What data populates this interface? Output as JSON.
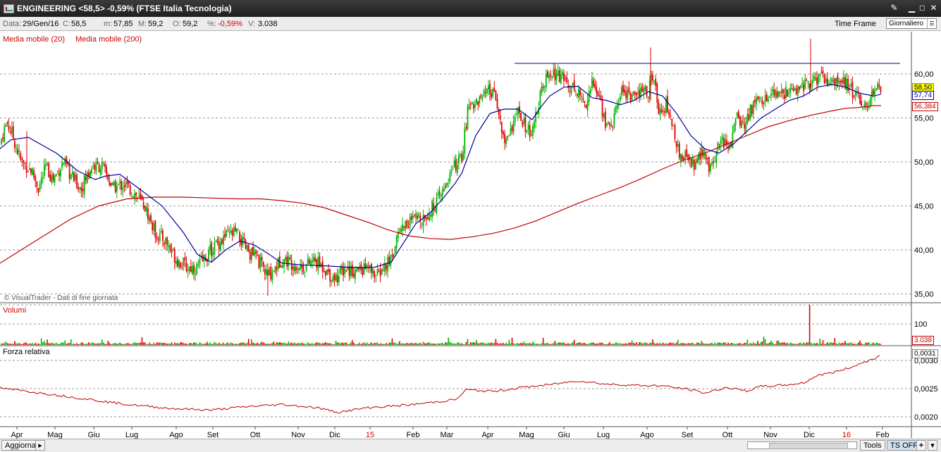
{
  "window": {
    "title": "ENGINEERING <58,5> -0,59%  (FTSE Italia Tecnologia)",
    "controls": [
      "pin-icon",
      "minimize-icon",
      "maximize-icon",
      "close-icon"
    ]
  },
  "info": {
    "date_label": "Data:",
    "date": "29/Gen/16",
    "close_label": "C:",
    "close": "58,5",
    "min_label": "m:",
    "min": "57,85",
    "max_label": "M:",
    "max": "59,2",
    "open_label": "O:",
    "open": "59,2",
    "pct_label": "%:",
    "pct": "-0,59%",
    "vol_label": "V:",
    "vol": "3.038",
    "timeframe_label": "Time Frame",
    "timeframe_value": "Giornaliero"
  },
  "indicators": {
    "ma20": "Media mobile (20)",
    "ma200": "Media mobile (200)",
    "copyright": "© VisualTrader - Dati di fine giornata",
    "volumes": "Volumi",
    "relative_strength": "Forza relativa"
  },
  "colors": {
    "up": "#00b400",
    "down": "#e00000",
    "ma20": "#0000a0",
    "ma200": "#c00000",
    "resistance": "#000080",
    "grid": "#9a9a9a",
    "price_box": "#ffff00",
    "ma_box": "#ffffff"
  },
  "chart_data": {
    "type": "candlestick",
    "price_axis": {
      "ticks": [
        "60,00",
        "55,00",
        "50,00",
        "45,00",
        "40,00",
        "35,00"
      ],
      "ylim": [
        34.5,
        64
      ]
    },
    "last_values": {
      "close": "58,50",
      "ma20": "57,74",
      "ma200": "56,384"
    },
    "volume_axis": {
      "ticks": [
        "100"
      ],
      "last": "3.038"
    },
    "rs_axis": {
      "ticks": [
        "0,0030",
        "0,0025",
        "0,0020"
      ],
      "last": "0,0031"
    },
    "x_labels": [
      "Apr",
      "Mag",
      "Giu",
      "Lug",
      "Ago",
      "Set",
      "Ott",
      "Nov",
      "Dic",
      "15",
      "Feb",
      "Mar",
      "Apr",
      "Mag",
      "Giu",
      "Lug",
      "Ago",
      "Set",
      "Ott",
      "Nov",
      "Dic",
      "16",
      "Feb"
    ],
    "x_label_red": [
      false,
      false,
      false,
      false,
      false,
      false,
      false,
      false,
      false,
      true,
      false,
      false,
      false,
      false,
      false,
      false,
      false,
      false,
      false,
      false,
      false,
      true,
      false
    ],
    "price_path": [
      [
        0,
        52
      ],
      [
        5,
        53.5
      ],
      [
        10,
        54.5
      ],
      [
        18,
        53
      ],
      [
        30,
        50
      ],
      [
        45,
        49
      ],
      [
        55,
        47
      ],
      [
        65,
        49.5
      ],
      [
        75,
        48
      ],
      [
        90,
        50
      ],
      [
        100,
        48.5
      ],
      [
        115,
        47
      ],
      [
        130,
        49.5
      ],
      [
        145,
        49.5
      ],
      [
        160,
        47
      ],
      [
        175,
        47.5
      ],
      [
        190,
        46.5
      ],
      [
        205,
        45
      ],
      [
        220,
        42
      ],
      [
        235,
        41
      ],
      [
        250,
        39
      ],
      [
        265,
        38
      ],
      [
        280,
        38
      ],
      [
        290,
        39
      ],
      [
        305,
        40.5
      ],
      [
        320,
        41.5
      ],
      [
        335,
        42
      ],
      [
        350,
        40
      ],
      [
        365,
        39
      ],
      [
        380,
        37
      ],
      [
        390,
        38
      ],
      [
        400,
        39
      ],
      [
        415,
        38.5
      ],
      [
        430,
        38
      ],
      [
        445,
        38.8
      ],
      [
        460,
        38
      ],
      [
        470,
        37
      ],
      [
        480,
        37
      ],
      [
        490,
        38
      ],
      [
        505,
        37.5
      ],
      [
        520,
        38
      ],
      [
        535,
        37
      ],
      [
        545,
        38
      ],
      [
        555,
        39
      ],
      [
        565,
        42
      ],
      [
        575,
        43
      ],
      [
        590,
        43.5
      ],
      [
        605,
        44
      ],
      [
        615,
        45
      ],
      [
        625,
        46
      ],
      [
        635,
        48
      ],
      [
        645,
        49.5
      ],
      [
        655,
        50.5
      ],
      [
        665,
        56.5
      ],
      [
        680,
        57
      ],
      [
        695,
        58
      ],
      [
        705,
        57
      ],
      [
        715,
        52
      ],
      [
        725,
        54
      ],
      [
        735,
        55.5
      ],
      [
        745,
        54
      ],
      [
        755,
        53
      ],
      [
        765,
        57
      ],
      [
        775,
        59.5
      ],
      [
        790,
        60
      ],
      [
        805,
        59
      ],
      [
        820,
        58
      ],
      [
        830,
        56.5
      ],
      [
        840,
        59
      ],
      [
        850,
        57.5
      ],
      [
        860,
        54
      ],
      [
        870,
        54.5
      ],
      [
        880,
        58
      ],
      [
        890,
        58
      ],
      [
        900,
        57
      ],
      [
        910,
        58
      ],
      [
        920,
        58
      ],
      [
        925,
        60
      ],
      [
        935,
        56
      ],
      [
        945,
        56.5
      ],
      [
        955,
        54
      ],
      [
        965,
        50
      ],
      [
        975,
        51
      ],
      [
        985,
        49.5
      ],
      [
        995,
        51
      ],
      [
        1005,
        49.5
      ],
      [
        1015,
        51
      ],
      [
        1025,
        52.5
      ],
      [
        1035,
        51.5
      ],
      [
        1045,
        55
      ],
      [
        1055,
        54
      ],
      [
        1065,
        56
      ],
      [
        1075,
        57
      ],
      [
        1085,
        57.5
      ],
      [
        1095,
        57.5
      ],
      [
        1105,
        57.5
      ],
      [
        1115,
        58
      ],
      [
        1125,
        58
      ],
      [
        1135,
        58.5
      ],
      [
        1145,
        59
      ],
      [
        1155,
        59
      ],
      [
        1165,
        59.5
      ],
      [
        1175,
        59
      ],
      [
        1185,
        59.5
      ],
      [
        1195,
        59
      ],
      [
        1205,
        58.5
      ],
      [
        1215,
        57.5
      ],
      [
        1225,
        56
      ],
      [
        1235,
        57
      ],
      [
        1245,
        58.5
      ],
      [
        1250,
        58.5
      ]
    ],
    "ma20_path": [
      [
        0,
        51.5
      ],
      [
        15,
        52.5
      ],
      [
        40,
        52.8
      ],
      [
        80,
        51
      ],
      [
        110,
        49
      ],
      [
        135,
        48
      ],
      [
        150,
        48.4
      ],
      [
        170,
        48.6
      ],
      [
        200,
        46.8
      ],
      [
        230,
        45
      ],
      [
        260,
        42
      ],
      [
        280,
        39.5
      ],
      [
        300,
        38.6
      ],
      [
        320,
        40
      ],
      [
        340,
        41
      ],
      [
        360,
        40.6
      ],
      [
        380,
        39.6
      ],
      [
        400,
        38.5
      ],
      [
        430,
        38.3
      ],
      [
        460,
        38.2
      ],
      [
        500,
        38
      ],
      [
        530,
        38
      ],
      [
        555,
        38.6
      ],
      [
        570,
        40.5
      ],
      [
        590,
        43
      ],
      [
        610,
        44.2
      ],
      [
        630,
        46
      ],
      [
        645,
        47.5
      ],
      [
        655,
        48.7
      ],
      [
        675,
        53
      ],
      [
        695,
        55.5
      ],
      [
        715,
        56
      ],
      [
        735,
        56
      ],
      [
        755,
        54.8
      ],
      [
        765,
        56
      ],
      [
        780,
        57.5
      ],
      [
        800,
        58.5
      ],
      [
        820,
        58.6
      ],
      [
        840,
        57.3
      ],
      [
        860,
        57
      ],
      [
        880,
        56.5
      ],
      [
        900,
        57
      ],
      [
        920,
        58
      ],
      [
        940,
        57.5
      ],
      [
        960,
        55.5
      ],
      [
        980,
        53
      ],
      [
        1000,
        51.5
      ],
      [
        1020,
        51
      ],
      [
        1040,
        52
      ],
      [
        1060,
        53.5
      ],
      [
        1080,
        55
      ],
      [
        1100,
        56
      ],
      [
        1120,
        57
      ],
      [
        1140,
        57.5
      ],
      [
        1160,
        58.5
      ],
      [
        1180,
        58.8
      ],
      [
        1200,
        58.5
      ],
      [
        1220,
        57.8
      ],
      [
        1240,
        57.5
      ],
      [
        1250,
        57.7
      ]
    ],
    "ma200_path": [
      [
        0,
        38.5
      ],
      [
        30,
        40
      ],
      [
        60,
        41.5
      ],
      [
        100,
        43.5
      ],
      [
        140,
        45
      ],
      [
        180,
        45.8
      ],
      [
        220,
        46
      ],
      [
        260,
        46
      ],
      [
        300,
        45.9
      ],
      [
        340,
        45.8
      ],
      [
        370,
        45.8
      ],
      [
        400,
        45.6
      ],
      [
        430,
        45.3
      ],
      [
        460,
        44.8
      ],
      [
        490,
        44
      ],
      [
        520,
        43.2
      ],
      [
        550,
        42.3
      ],
      [
        580,
        41.6
      ],
      [
        610,
        41.3
      ],
      [
        640,
        41.2
      ],
      [
        670,
        41.5
      ],
      [
        700,
        41.9
      ],
      [
        730,
        42.5
      ],
      [
        760,
        43.3
      ],
      [
        790,
        44.3
      ],
      [
        820,
        45.3
      ],
      [
        850,
        46.2
      ],
      [
        880,
        47.1
      ],
      [
        910,
        48.1
      ],
      [
        940,
        49.2
      ],
      [
        970,
        50.2
      ],
      [
        1000,
        51
      ],
      [
        1030,
        52
      ],
      [
        1060,
        53
      ],
      [
        1090,
        54
      ],
      [
        1120,
        54.7
      ],
      [
        1150,
        55.3
      ],
      [
        1180,
        55.8
      ],
      [
        1200,
        56.1
      ],
      [
        1220,
        56.2
      ],
      [
        1240,
        56.4
      ],
      [
        1250,
        56.4
      ]
    ],
    "resistance": [
      [
        730,
        61.2
      ],
      [
        1277,
        61.2
      ]
    ],
    "rs_path": [
      [
        0,
        0.00251
      ],
      [
        60,
        0.00242
      ],
      [
        120,
        0.00232
      ],
      [
        180,
        0.00222
      ],
      [
        240,
        0.00215
      ],
      [
        300,
        0.00212
      ],
      [
        350,
        0.00218
      ],
      [
        400,
        0.00222
      ],
      [
        450,
        0.00216
      ],
      [
        480,
        0.00208
      ],
      [
        520,
        0.00216
      ],
      [
        580,
        0.00221
      ],
      [
        630,
        0.00228
      ],
      [
        650,
        0.00232
      ],
      [
        660,
        0.00248
      ],
      [
        700,
        0.00245
      ],
      [
        740,
        0.00252
      ],
      [
        780,
        0.00257
      ],
      [
        820,
        0.00264
      ],
      [
        860,
        0.00258
      ],
      [
        900,
        0.00256
      ],
      [
        940,
        0.00255
      ],
      [
        980,
        0.00248
      ],
      [
        1000,
        0.00242
      ],
      [
        1030,
        0.00252
      ],
      [
        1060,
        0.00246
      ],
      [
        1080,
        0.00254
      ],
      [
        1110,
        0.00256
      ],
      [
        1140,
        0.0026
      ],
      [
        1160,
        0.00274
      ],
      [
        1180,
        0.00278
      ],
      [
        1200,
        0.00285
      ],
      [
        1220,
        0.00294
      ],
      [
        1245,
        0.00306
      ],
      [
        1250,
        0.0031
      ]
    ],
    "volume_spike_at": 1148
  },
  "status": {
    "refresh": "Aggiorna",
    "tools": "Tools",
    "ts": "TS OFF",
    "plus": "+",
    "arrow": "▸"
  }
}
